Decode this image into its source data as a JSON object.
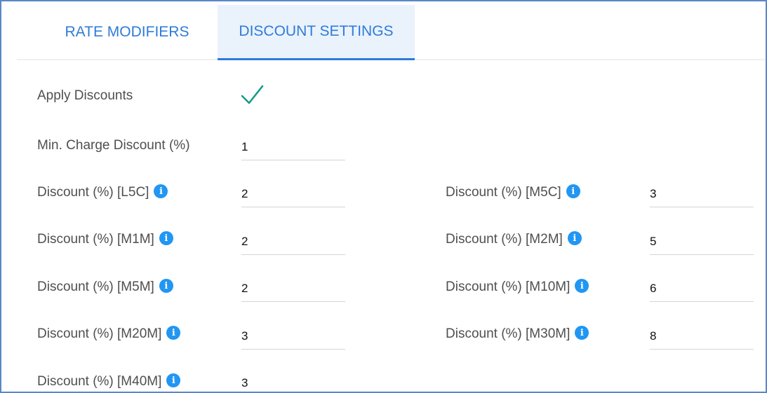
{
  "tabs": [
    {
      "label": "RATE MODIFIERS",
      "active": false
    },
    {
      "label": "DISCOUNT SETTINGS",
      "active": true
    }
  ],
  "apply_discounts": {
    "label": "Apply Discounts",
    "checked": true,
    "icon": "checkmark-icon",
    "color": "#1a9a8a"
  },
  "min_charge": {
    "label": "Min. Charge Discount (%)",
    "value": "1"
  },
  "discounts": [
    {
      "label": "Discount (%) [L5C]",
      "value": "2"
    },
    {
      "label": "Discount (%) [M5C]",
      "value": "3"
    },
    {
      "label": "Discount (%) [M1M]",
      "value": "2"
    },
    {
      "label": "Discount (%) [M2M]",
      "value": "5"
    },
    {
      "label": "Discount (%) [M5M]",
      "value": "2"
    },
    {
      "label": "Discount (%) [M10M]",
      "value": "6"
    },
    {
      "label": "Discount (%) [M20M]",
      "value": "3"
    },
    {
      "label": "Discount (%) [M30M]",
      "value": "8"
    },
    {
      "label": "Discount (%) [M40M]",
      "value": "3"
    }
  ],
  "info_icon": "info-icon",
  "accent_color": "#2f7bd9"
}
